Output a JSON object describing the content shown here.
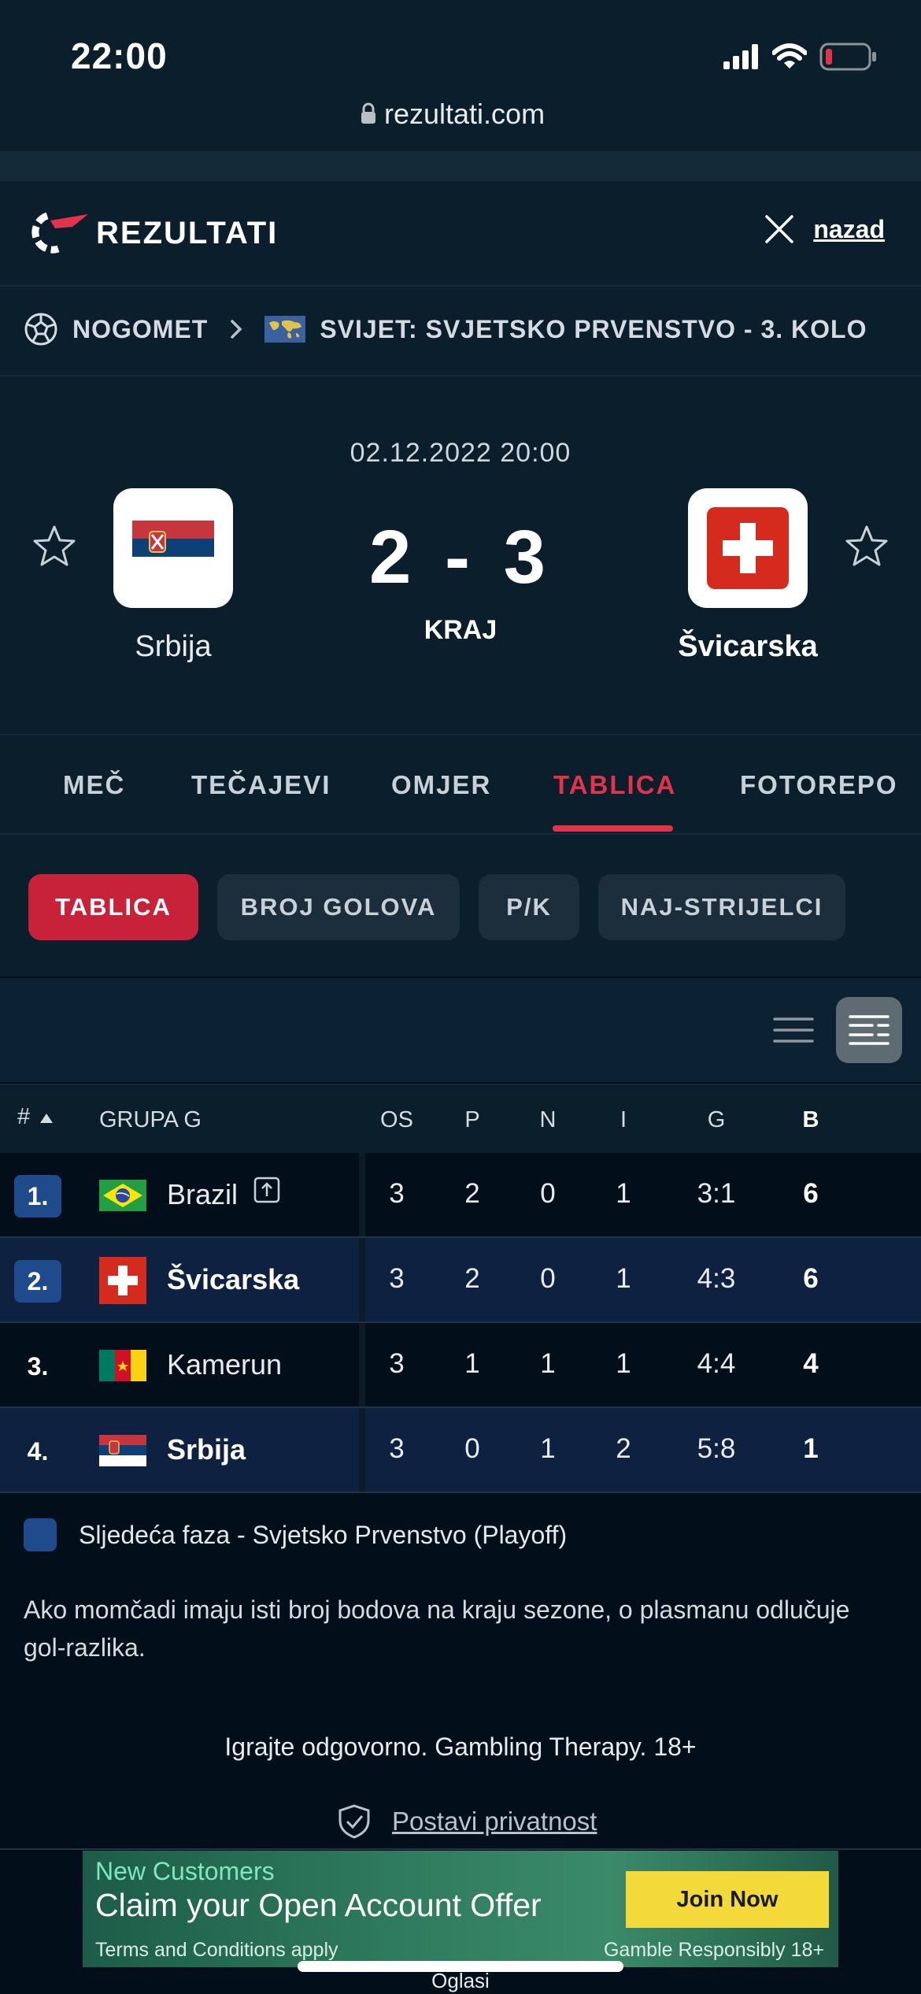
{
  "status_bar": {
    "time": "22:00"
  },
  "browser": {
    "url": "rezultati.com"
  },
  "header": {
    "logo_text": "REZULTATI",
    "back_label": "nazad"
  },
  "breadcrumb": {
    "sport": "NOGOMET",
    "competition": "SVIJET: SVJETSKO PRVENSTVO - 3. KOLO"
  },
  "match": {
    "datetime": "02.12.2022 20:00",
    "home_team": "Srbija",
    "away_team": "Švicarska",
    "score": "2 - 3",
    "status": "KRAJ"
  },
  "tabs": [
    {
      "label": "MEČ",
      "active": false
    },
    {
      "label": "TEČAJEVI",
      "active": false
    },
    {
      "label": "OMJER",
      "active": false
    },
    {
      "label": "TABLICA",
      "active": true
    },
    {
      "label": "FOTOREPO",
      "active": false
    }
  ],
  "subtabs": [
    {
      "label": "TABLICA",
      "active": true
    },
    {
      "label": "BROJ GOLOVA",
      "active": false
    },
    {
      "label": "P/K",
      "active": false
    },
    {
      "label": "NAJ-STRIJELCI",
      "active": false
    }
  ],
  "table": {
    "headers": {
      "rank": "#",
      "group": "GRUPA G",
      "played": "OS",
      "won": "P",
      "draw": "N",
      "lost": "I",
      "goals": "G",
      "points": "B"
    },
    "rows": [
      {
        "rank": "1.",
        "team": "Brazil",
        "played": "3",
        "won": "2",
        "draw": "0",
        "lost": "1",
        "goals": "3:1",
        "points": "6",
        "qualified": true,
        "flag": "brazil-flag"
      },
      {
        "rank": "2.",
        "team": "Švicarska",
        "played": "3",
        "won": "2",
        "draw": "0",
        "lost": "1",
        "goals": "4:3",
        "points": "6",
        "qualified": true,
        "flag": "switzerland-flag"
      },
      {
        "rank": "3.",
        "team": "Kamerun",
        "played": "3",
        "won": "1",
        "draw": "1",
        "lost": "1",
        "goals": "4:4",
        "points": "4",
        "qualified": false,
        "flag": "cameroon-flag"
      },
      {
        "rank": "4.",
        "team": "Srbija",
        "played": "3",
        "won": "0",
        "draw": "1",
        "lost": "2",
        "goals": "5:8",
        "points": "1",
        "qualified": false,
        "flag": "serbia-flag"
      }
    ]
  },
  "legend": {
    "label": "Sljedeća faza - Svjetsko Prvenstvo (Playoff)",
    "color": "#1f4b8c"
  },
  "note": "Ako momčadi imaju isti broj bodova na kraju sezone, o plasmanu odlučuje gol-razlika.",
  "responsible": "Igrajte odgovorno. Gambling Therapy. 18+",
  "privacy": "Postavi privatnost",
  "ad": {
    "line1": "New Customers",
    "line2": "Claim your Open Account Offer",
    "terms": "Terms and Conditions apply",
    "gamble": "Gamble Responsibly 18+",
    "button": "Join Now",
    "footer_label": "Oglasi"
  },
  "colors": {
    "accent": "#e3334a",
    "qualified": "#1f4b8c",
    "background": "#020f1a"
  }
}
